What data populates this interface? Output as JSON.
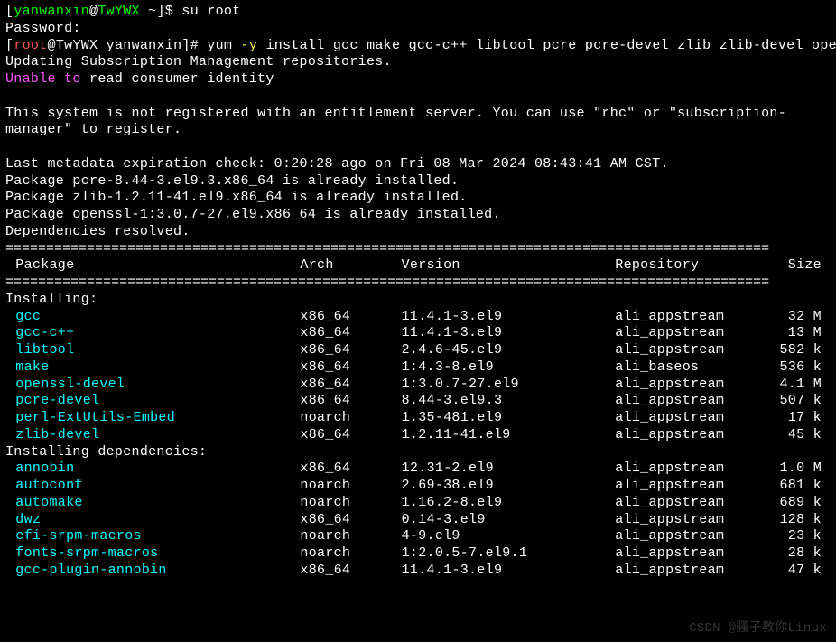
{
  "prompt1": {
    "user": "yanwanxin",
    "host": "TwYWX",
    "path": "~",
    "symbol": "$",
    "cmd": "su root"
  },
  "password_label": "Password:",
  "prompt2": {
    "user": "root",
    "host": "TwYWX",
    "path": "yanwanxin",
    "symbol": "#",
    "cmd_prefix": "yum ",
    "cmd_flag": "-y",
    "cmd_rest": " install gcc make gcc-c++ libtool pcre pcre-devel zlib zlib-devel openssl openssl-devel perl-ExtUtils-Embed"
  },
  "msg_updating": "Updating Subscription Management repositories.",
  "msg_unable_part1": "Unable to ",
  "msg_unable_part2": "read consumer identity",
  "msg_notregistered": "This system is not registered with an entitlement server. You can use \"rhc\" or \"subscription-manager\" to register.",
  "msg_metadata": "Last metadata expiration check: 0:20:28 ago on Fri 08 Mar 2024 08:43:41 AM CST.",
  "msg_pkg_pcre": "Package pcre-8.44-3.el9.3.x86_64 is already installed.",
  "msg_pkg_zlib": "Package zlib-1.2.11-41.el9.x86_64 is already installed.",
  "msg_pkg_openssl": "Package openssl-1:3.0.7-27.el9.x86_64 is already installed.",
  "msg_deps": "Dependencies resolved.",
  "divider": "==============================================================================================",
  "header": {
    "c1": " Package",
    "c2": "Arch",
    "c3": "Version",
    "c4": "Repository",
    "c5": "Size"
  },
  "section_installing": "Installing:",
  "section_deps": "Installing dependencies:",
  "packages": [
    {
      "name": " gcc",
      "arch": "x86_64",
      "version": "11.4.1-3.el9",
      "repo": "ali_appstream",
      "size": "32 M"
    },
    {
      "name": " gcc-c++",
      "arch": "x86_64",
      "version": "11.4.1-3.el9",
      "repo": "ali_appstream",
      "size": "13 M"
    },
    {
      "name": " libtool",
      "arch": "x86_64",
      "version": "2.4.6-45.el9",
      "repo": "ali_appstream",
      "size": "582 k"
    },
    {
      "name": " make",
      "arch": "x86_64",
      "version": "1:4.3-8.el9",
      "repo": "ali_baseos",
      "size": "536 k"
    },
    {
      "name": " openssl-devel",
      "arch": "x86_64",
      "version": "1:3.0.7-27.el9",
      "repo": "ali_appstream",
      "size": "4.1 M"
    },
    {
      "name": " pcre-devel",
      "arch": "x86_64",
      "version": "8.44-3.el9.3",
      "repo": "ali_appstream",
      "size": "507 k"
    },
    {
      "name": " perl-ExtUtils-Embed",
      "arch": "noarch",
      "version": "1.35-481.el9",
      "repo": "ali_appstream",
      "size": "17 k"
    },
    {
      "name": " zlib-devel",
      "arch": "x86_64",
      "version": "1.2.11-41.el9",
      "repo": "ali_appstream",
      "size": "45 k"
    }
  ],
  "dep_packages": [
    {
      "name": " annobin",
      "arch": "x86_64",
      "version": "12.31-2.el9",
      "repo": "ali_appstream",
      "size": "1.0 M"
    },
    {
      "name": " autoconf",
      "arch": "noarch",
      "version": "2.69-38.el9",
      "repo": "ali_appstream",
      "size": "681 k"
    },
    {
      "name": " automake",
      "arch": "noarch",
      "version": "1.16.2-8.el9",
      "repo": "ali_appstream",
      "size": "689 k"
    },
    {
      "name": " dwz",
      "arch": "x86_64",
      "version": "0.14-3.el9",
      "repo": "ali_appstream",
      "size": "128 k"
    },
    {
      "name": " efi-srpm-macros",
      "arch": "noarch",
      "version": "4-9.el9",
      "repo": "ali_appstream",
      "size": "23 k"
    },
    {
      "name": " fonts-srpm-macros",
      "arch": "noarch",
      "version": "1:2.0.5-7.el9.1",
      "repo": "ali_appstream",
      "size": "28 k"
    },
    {
      "name": " gcc-plugin-annobin",
      "arch": "x86_64",
      "version": "11.4.1-3.el9",
      "repo": "ali_appstream",
      "size": "47 k"
    }
  ],
  "watermark": "CSDN @骚子教你Linux"
}
